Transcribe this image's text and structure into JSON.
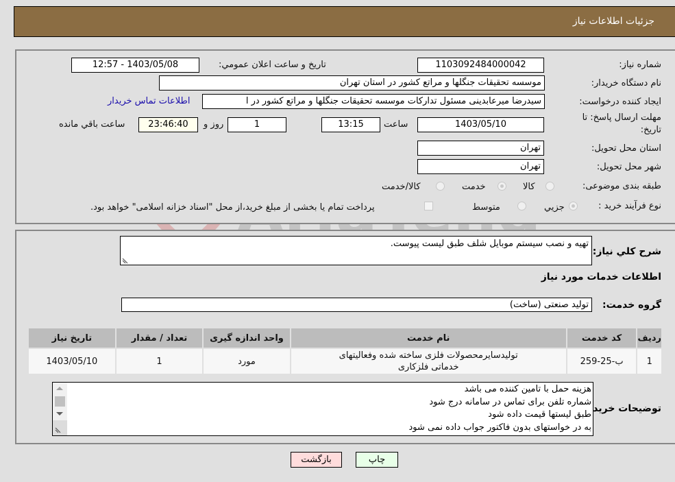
{
  "header": {
    "title": "جزئیات اطلاعات نیاز"
  },
  "form": {
    "need_number": {
      "label": "شماره نیاز:",
      "value": "1103092484000042"
    },
    "announce_datetime": {
      "label": "تاریخ و ساعت اعلان عمومي:",
      "value": "1403/05/08 - 12:57"
    },
    "buyer_org": {
      "label": "نام دستگاه خريدار:",
      "value": "موسسه تحقیقات جنگلها و مراتع کشور در استان تهران"
    },
    "requester": {
      "label": "ایجاد کننده درخواست:",
      "value": "سیدرضا میرعابدینی مسئول تدارکات موسسه تحقیقات جنگلها و مراتع کشور در ا",
      "contact_link": "اطلاعات تماس خریدار"
    },
    "deadline": {
      "label_line1": "مهلت ارسال پاسخ: تا",
      "label_line2": "تاریخ:",
      "date": "1403/05/10",
      "time_label": "ساعت",
      "time": "13:15",
      "days": "1",
      "days_label": "روز و",
      "remaining": "23:46:40",
      "remaining_label": "ساعت باقي مانده"
    },
    "province": {
      "label": "استان محل تحویل:",
      "value": "تهران"
    },
    "city": {
      "label": "شهر محل تحویل:",
      "value": "تهران"
    },
    "category": {
      "label": "طبقه بندی موضوعی:",
      "options": [
        {
          "label": "کالا",
          "checked": false
        },
        {
          "label": "خدمت",
          "checked": true
        },
        {
          "label": "کالا/خدمت",
          "checked": false
        }
      ]
    },
    "purchase_type": {
      "label": "نوع فرآیند خرید :",
      "options": [
        {
          "label": "جزيي",
          "checked": true
        },
        {
          "label": "متوسط",
          "checked": false
        }
      ],
      "treasury_note": "پرداخت تمام یا بخشی از مبلغ خرید،از محل \"اسناد خزانه اسلامی\" خواهد بود.",
      "treasury_checked": false
    }
  },
  "details": {
    "description_label": "شرح كلي نياز:",
    "description": "تهیه و نصب سیستم موبایل شلف طبق لیست پیوست.",
    "services_heading": "اطلاعات خدمات مورد نیاز",
    "service_group_label": "گروه خدمت:",
    "service_group": "تولید صنعتی (ساخت)",
    "table": {
      "headers": [
        "ردیف",
        "کد خدمت",
        "نام خدمت",
        "واحد اندازه گیری",
        "تعداد / مقدار",
        "تاریخ نیاز"
      ],
      "rows": [
        [
          "1",
          "ب-25-259",
          "تولیدسایرمحصولات فلزی ساخته شده وفعالیتهای خدماتی فلزکاری",
          "مورد",
          "1",
          "1403/05/10"
        ]
      ]
    },
    "buyer_notes_label": "توضیحات خریدار:",
    "buyer_notes": [
      "هزینه حمل با تامین کننده می باشد",
      "شماره تلفن برای تماس در سامانه درج شود",
      "طبق لیستها قیمت داده شود",
      "به در خواستهای بدون فاکتور جواب داده نمی شود"
    ]
  },
  "buttons": {
    "back": "بازگشت",
    "print": "چاپ"
  },
  "watermark": {
    "text": "AriaTender.neT"
  },
  "colors": {
    "header_bg": "#8b6d43",
    "link": "#1a0dab",
    "back_btn": "#ffdcdc",
    "print_btn": "#e8ffe8",
    "remaining_bg": "#ffffee"
  }
}
